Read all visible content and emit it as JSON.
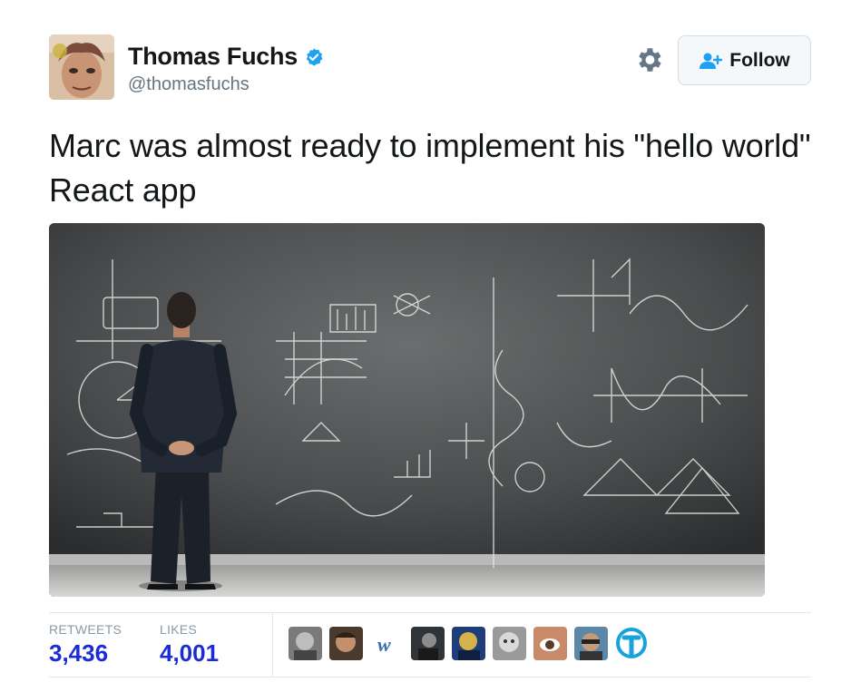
{
  "author": {
    "name": "Thomas Fuchs",
    "handle": "@thomasfuchs",
    "verified": true
  },
  "actions": {
    "follow_label": "Follow",
    "settings_icon": "gear-icon",
    "follow_icon": "add-user-icon"
  },
  "tweet": {
    "text": "Marc was almost ready to implement his \"hello world\" React app"
  },
  "stats": {
    "retweets_label": "RETWEETS",
    "retweets_value": "3,436",
    "likes_label": "LIKES",
    "likes_value": "4,001"
  },
  "colors": {
    "stat_value": "#1b2cd6",
    "verified_badge": "#1da1f2",
    "text": "#14171a",
    "secondary": "#66757f"
  }
}
